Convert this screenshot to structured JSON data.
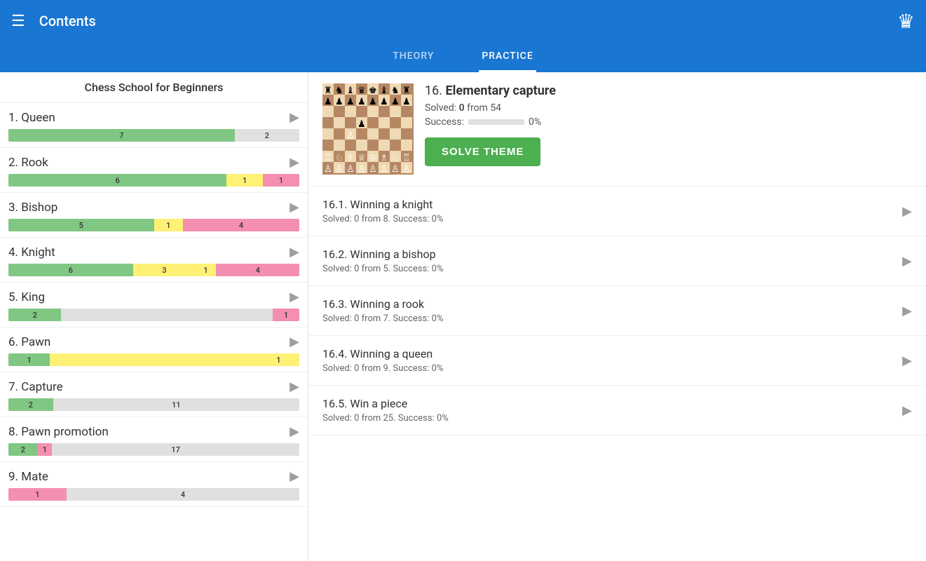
{
  "header": {
    "title": "Contents",
    "crown_icon": "♛"
  },
  "tabs": [
    {
      "label": "THEORY",
      "active": false
    },
    {
      "label": "PRACTICE",
      "active": true
    }
  ],
  "sidebar": {
    "title": "Chess School for Beginners",
    "items": [
      {
        "id": 1,
        "name": "1. Queen",
        "bars": [
          {
            "color": "green",
            "value": "7",
            "flex": 7
          },
          {
            "color": "empty",
            "value": "2",
            "flex": 2
          }
        ]
      },
      {
        "id": 2,
        "name": "2. Rook",
        "bars": [
          {
            "color": "green",
            "value": "6",
            "flex": 6
          },
          {
            "color": "yellow",
            "value": "1",
            "flex": 1
          },
          {
            "color": "pink",
            "value": "1",
            "flex": 1
          }
        ]
      },
      {
        "id": 3,
        "name": "3. Bishop",
        "bars": [
          {
            "color": "green",
            "value": "5",
            "flex": 5
          },
          {
            "color": "yellow",
            "value": "1",
            "flex": 1
          },
          {
            "color": "pink",
            "value": "4",
            "flex": 4
          }
        ]
      },
      {
        "id": 4,
        "name": "4. Knight",
        "bars": [
          {
            "color": "green",
            "value": "6",
            "flex": 6
          },
          {
            "color": "yellow",
            "value": "3",
            "flex": 3
          },
          {
            "color": "yellow",
            "value": "1",
            "flex": 1
          },
          {
            "color": "pink",
            "value": "4",
            "flex": 4
          }
        ]
      },
      {
        "id": 5,
        "name": "5. King",
        "bars": [
          {
            "color": "green",
            "value": "2",
            "flex": 2
          },
          {
            "color": "empty",
            "value": "",
            "flex": 6
          },
          {
            "color": "pink",
            "value": "1",
            "flex": 1
          }
        ]
      },
      {
        "id": 6,
        "name": "6. Pawn",
        "bars": [
          {
            "color": "green",
            "value": "1",
            "flex": 1
          },
          {
            "color": "yellow",
            "value": "",
            "flex": 5
          },
          {
            "color": "yellow",
            "value": "1",
            "flex": 1
          }
        ]
      },
      {
        "id": 7,
        "name": "7. Capture",
        "bars": [
          {
            "color": "green",
            "value": "2",
            "flex": 2
          },
          {
            "color": "empty",
            "value": "11",
            "flex": 11
          }
        ]
      },
      {
        "id": 8,
        "name": "8. Pawn promotion",
        "bars": [
          {
            "color": "green",
            "value": "2",
            "flex": 2
          },
          {
            "color": "pink",
            "value": "1",
            "flex": 1
          },
          {
            "color": "empty",
            "value": "17",
            "flex": 17
          }
        ]
      },
      {
        "id": 9,
        "name": "9. Mate",
        "bars": [
          {
            "color": "pink",
            "value": "1",
            "flex": 1
          },
          {
            "color": "empty",
            "value": "4",
            "flex": 4
          }
        ]
      }
    ]
  },
  "lesson": {
    "number": "16.",
    "title": "Elementary capture",
    "solved_count": "0",
    "solved_total": "54",
    "success_label": "Success:",
    "success_value": "0%",
    "solve_button": "SOLVE THEME",
    "sub_lessons": [
      {
        "id": "16.1.",
        "title": "Winning a knight",
        "solved": "0",
        "total": "8",
        "success": "0%"
      },
      {
        "id": "16.2.",
        "title": "Winning a bishop",
        "solved": "0",
        "total": "5",
        "success": "0%"
      },
      {
        "id": "16.3.",
        "title": "Winning a rook",
        "solved": "0",
        "total": "7",
        "success": "0%"
      },
      {
        "id": "16.4.",
        "title": "Winning a queen",
        "solved": "0",
        "total": "9",
        "success": "0%"
      },
      {
        "id": "16.5.",
        "title": "Win a piece",
        "solved": "0",
        "total": "25",
        "success": "0%"
      }
    ]
  }
}
